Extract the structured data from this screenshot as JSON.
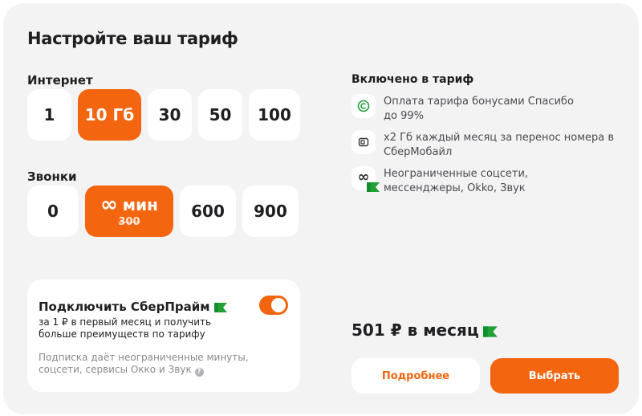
{
  "title": "Настройте ваш тариф",
  "internet": {
    "label": "Интернет",
    "options": [
      {
        "label": "1"
      },
      {
        "label": "10 Гб"
      },
      {
        "label": "30"
      },
      {
        "label": "50"
      },
      {
        "label": "100"
      }
    ],
    "selected": "10 Гб"
  },
  "calls": {
    "label": "Звонки",
    "options": [
      {
        "label": "0"
      },
      {
        "label": "∞ мин",
        "symbol": "∞",
        "unit": "мин",
        "old": "300"
      },
      {
        "label": "600"
      },
      {
        "label": "900"
      }
    ],
    "selected": "∞ мин"
  },
  "prime": {
    "title": "Подключить СберПрайм",
    "desc": "за 1 ₽ в первый месяц и получить больше преимуществ по тарифу",
    "note": "Подписка даёт неограниченные минуты, соцсети, сервисы Окко и Звук",
    "toggle_on": true
  },
  "included": {
    "title": "Включено в тариф",
    "features": [
      {
        "icon": "spasibo-icon",
        "text": "Оплата тарифа бонусами Спасибо до 99%"
      },
      {
        "icon": "sim-card-icon",
        "text": "х2 Гб каждый месяц за перенос номера в СберМобайл"
      },
      {
        "icon": "infinity-icon",
        "text": "Неограниченные соцсети, мессенджеры, Okko, Звук"
      }
    ]
  },
  "price": "501 ₽ в месяц",
  "buttons": {
    "more": "Подробнее",
    "choose": "Выбрать"
  },
  "colors": {
    "accent": "#f3650f",
    "background": "#f3f3f4",
    "badge_green": "#21a038"
  }
}
